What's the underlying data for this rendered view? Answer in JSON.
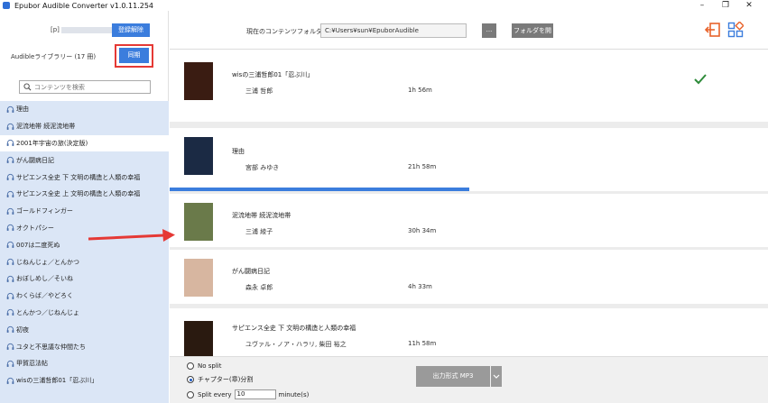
{
  "window": {
    "title": "Epubor Audible Converter v1.0.11.254",
    "controls": [
      "–",
      "❐",
      "✕"
    ]
  },
  "sidebar": {
    "account_prefix": "[p]",
    "logout_label": "登録解除",
    "library_label": "Audibleライブラリー (17 冊)",
    "sync_label": "同期",
    "search_placeholder": "コンテンツを検索",
    "selected_index": 2,
    "items": [
      "理由",
      "泥流地帯 続泥流地帯",
      "2001年宇宙の旅(決定版)",
      "がん闘病日記",
      "サピエンス全史 下 文明の構造と人類の幸福",
      "サピエンス全史 上 文明の構造と人類の幸福",
      "ゴールドフィンガー",
      "オクトパシー",
      "007は二度死ぬ",
      "じねんじょ／とんかつ",
      "おぼしめし／そいね",
      "わくらば／やどろく",
      "とんかつ／じねんじょ",
      "初夜",
      "ユタと不思議な仲間たち",
      "甲賀忍法帖",
      "wisの三浦哲郎01「忍ぶ川」"
    ]
  },
  "topbar": {
    "folder_label": "現在のコンテンツフォルダ:",
    "folder_path": "C:¥Users¥sun¥EpuborAudible",
    "browse_label": "...",
    "open_folder_label": "フォルダを開",
    "icons": [
      "exit-icon",
      "apps-icon"
    ],
    "accent": "#e8632b"
  },
  "books": [
    {
      "title": "wisの三浦哲郎01「忍ぶ川」",
      "author": "三浦 哲郎",
      "duration": "1h 56m",
      "status": "done",
      "cover": "#3a1c12"
    },
    {
      "title": "理由",
      "author": "宮部 みゆき",
      "duration": "21h 58m",
      "progress": 0.5,
      "cover": "#1b2a44"
    },
    {
      "title": "泥流地帯 続泥流地帯",
      "author": "三浦 綾子",
      "duration": "30h 34m",
      "cover": "#6a7a4a"
    },
    {
      "title": "がん闘病日記",
      "author": "森永 卓郎",
      "duration": "4h 33m",
      "cover": "#d7b6a0"
    },
    {
      "title": "サピエンス全史 下 文明の構造と人類の幸福",
      "author": "ユヴァル・ノア・ハラリ, 柴田 裕之",
      "duration": "11h 58m",
      "cover": "#2a1a10"
    }
  ],
  "footer": {
    "options": [
      "No split",
      "チャプター(章)分割",
      "Split every"
    ],
    "selected_option": 1,
    "split_value": "10",
    "split_unit": "minute(s)",
    "format_label": "出力形式 MP3"
  },
  "colors": {
    "primary": "#3b7ddd",
    "sidebar_bg": "#dbe6f6",
    "highlight_red": "#e53935",
    "check_green": "#2e8b3a"
  }
}
